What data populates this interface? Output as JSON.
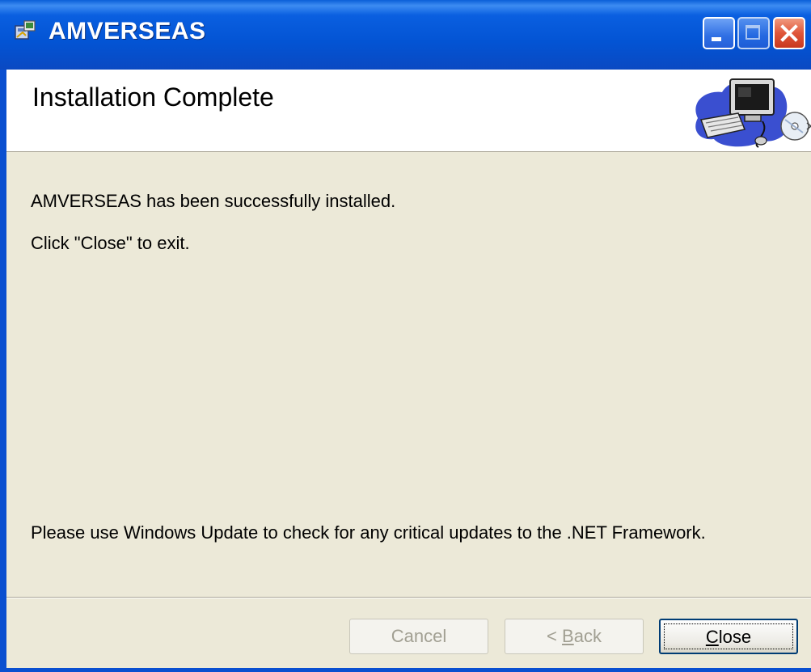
{
  "window": {
    "title": "AMVERSEAS"
  },
  "banner": {
    "heading": "Installation Complete",
    "art_icon": "computer-install-icon"
  },
  "messages": {
    "success": "AMVERSEAS has been successfully installed.",
    "exit_hint": "Click \"Close\" to exit.",
    "update_note": "Please use Windows Update to check for any critical updates to the .NET Framework."
  },
  "buttons": {
    "cancel": {
      "label": "Cancel",
      "enabled": false
    },
    "back": {
      "prefix": "< ",
      "accel": "B",
      "rest": "ack",
      "enabled": false
    },
    "close": {
      "accel": "C",
      "rest": "lose",
      "enabled": true,
      "default": true
    }
  },
  "colors": {
    "titlebar": "#0a5fe0",
    "dialog_bg": "#ece9d8",
    "close_button": "#e0563a"
  }
}
